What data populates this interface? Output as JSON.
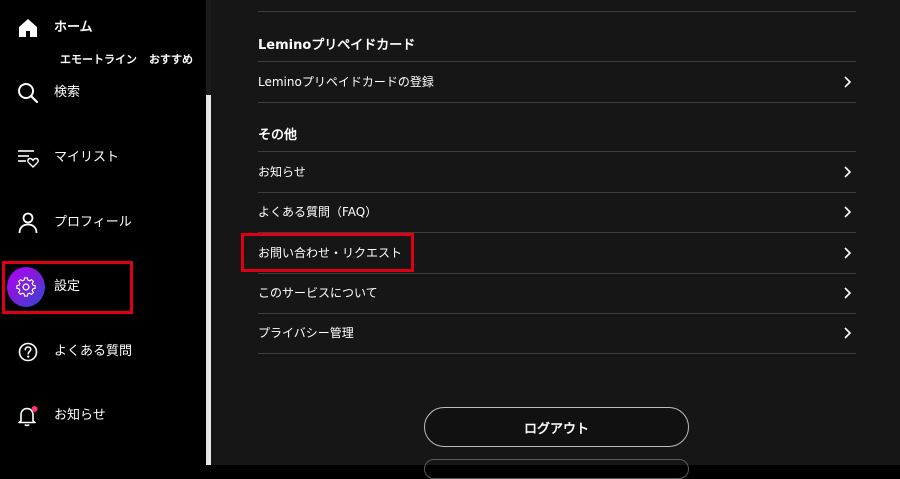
{
  "sidebar": {
    "home_label": "ホーム",
    "subtabs": [
      "エモートライン",
      "おすすめ"
    ],
    "items": [
      {
        "label": "検索",
        "icon": "search-icon"
      },
      {
        "label": "マイリスト",
        "icon": "mylist-icon"
      },
      {
        "label": "プロフィール",
        "icon": "profile-icon"
      },
      {
        "label": "設定",
        "icon": "gear-icon"
      },
      {
        "label": "よくある質問",
        "icon": "help-icon"
      },
      {
        "label": "お知らせ",
        "icon": "bell-icon"
      }
    ],
    "active_item": "設定",
    "notification_dot_color": "#ff2e7a"
  },
  "main": {
    "sections": [
      {
        "heading": "Leminoプリペイドカード",
        "rows": [
          "Leminoプリペイドカードの登録"
        ]
      },
      {
        "heading": "その他",
        "rows": [
          "お知らせ",
          "よくある質問（FAQ）",
          "お問い合わせ・リクエスト",
          "このサービスについて",
          "プライバシー管理"
        ]
      }
    ],
    "logout_label": "ログアウト"
  },
  "colors": {
    "highlight": "#e00014",
    "settings_gradient_start": "#b400ff",
    "settings_gradient_end": "#2e49d8",
    "main_background": "#161616"
  }
}
